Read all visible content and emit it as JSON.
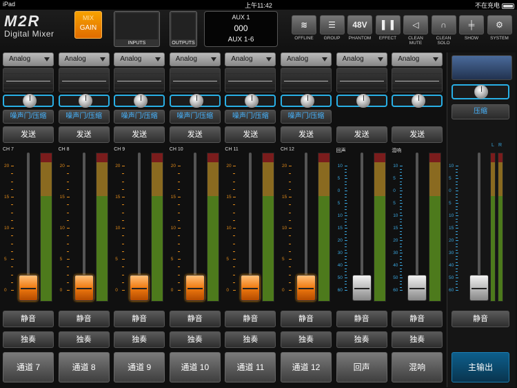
{
  "status": {
    "device": "iPad",
    "time": "上午11:42",
    "battery": "不在充电"
  },
  "header": {
    "logo_top": "M2R",
    "logo_bottom": "Digital Mixer",
    "mix_label": "MIX",
    "gain_label": "GAIN",
    "inputs_label": "INPUTS",
    "outputs_label": "OUTPUTS",
    "aux": {
      "name": "AUX 1",
      "value": "000",
      "range": "AUX 1-6"
    },
    "buttons": [
      {
        "icon": "wifi-icon",
        "glyph": "≋",
        "label": "OFFLINE"
      },
      {
        "icon": "group-icon",
        "glyph": "☰",
        "label": "GROUP"
      },
      {
        "icon": "phantom-icon",
        "glyph": "48V",
        "label": "PHANTOM"
      },
      {
        "icon": "effect-icon",
        "glyph": "▌▐",
        "label": "EFFECT"
      },
      {
        "icon": "mute-icon",
        "glyph": "◁",
        "label": "CLEAN\nMUTE"
      },
      {
        "icon": "headphones-icon",
        "glyph": "∩",
        "label": "CLEAN\nSOLO"
      },
      {
        "icon": "show-icon",
        "glyph": "╪",
        "label": "SHOW"
      },
      {
        "icon": "gear-icon",
        "glyph": "⚙",
        "label": "SYSTEM"
      }
    ]
  },
  "channels": [
    {
      "input": "Analog",
      "label": "CH 7",
      "dyn": "噪声门/压缩",
      "send": "发送",
      "mute": "静音",
      "solo": "独奏",
      "name": "通道 7",
      "type": "input",
      "fader_db": 0,
      "meter_level": 0
    },
    {
      "input": "Analog",
      "label": "CH 8",
      "dyn": "噪声门/压缩",
      "send": "发送",
      "mute": "静音",
      "solo": "独奏",
      "name": "通道 8",
      "type": "input",
      "fader_db": 0,
      "meter_level": 0
    },
    {
      "input": "Analog",
      "label": "CH 9",
      "dyn": "噪声门/压缩",
      "send": "发送",
      "mute": "静音",
      "solo": "独奏",
      "name": "通道 9",
      "type": "input",
      "fader_db": 0,
      "meter_level": 0
    },
    {
      "input": "Analog",
      "label": "CH 10",
      "dyn": "噪声门/压缩",
      "send": "发送",
      "mute": "静音",
      "solo": "独奏",
      "name": "通道 10",
      "type": "input",
      "fader_db": 0,
      "meter_level": 0
    },
    {
      "input": "Analog",
      "label": "CH 11",
      "dyn": "噪声门/压缩",
      "send": "发送",
      "mute": "静音",
      "solo": "独奏",
      "name": "通道 11",
      "type": "input",
      "fader_db": 0,
      "meter_level": 0
    },
    {
      "input": "Analog",
      "label": "CH 12",
      "dyn": "噪声门/压缩",
      "send": "发送",
      "mute": "静音",
      "solo": "独奏",
      "name": "通道 12",
      "type": "input",
      "fader_db": 0,
      "meter_level": 0
    },
    {
      "input": "Analog",
      "label": "回声",
      "dyn": "",
      "send": "发送",
      "mute": "静音",
      "solo": "独奏",
      "name": "回声",
      "type": "fx",
      "fader_db": -60,
      "meter_level": 0
    },
    {
      "input": "Analog",
      "label": "混响",
      "dyn": "",
      "send": "发送",
      "mute": "静音",
      "solo": "独奏",
      "name": "混响",
      "type": "fx",
      "fader_db": -60,
      "meter_level": 0
    }
  ],
  "scales": {
    "input": [
      "20",
      "15",
      "10",
      "5",
      "0"
    ],
    "fx": [
      "10",
      "5",
      "0",
      "5",
      "10",
      "15",
      "20",
      "30",
      "40",
      "50",
      "60"
    ],
    "main": [
      "10",
      "5",
      "0",
      "5",
      "10",
      "15",
      "20",
      "30",
      "40",
      "50",
      "60"
    ]
  },
  "main": {
    "comp": "压缩",
    "mute": "静音",
    "name": "主输出",
    "meter_l": "L",
    "meter_r": "R",
    "fader_db": 0
  },
  "colors": {
    "accent": "#29b0e6",
    "orange": "#f07a10",
    "meter_green": "#4d7a1c",
    "meter_yellow": "#8a6a20",
    "meter_red": "#7a1c1c"
  }
}
